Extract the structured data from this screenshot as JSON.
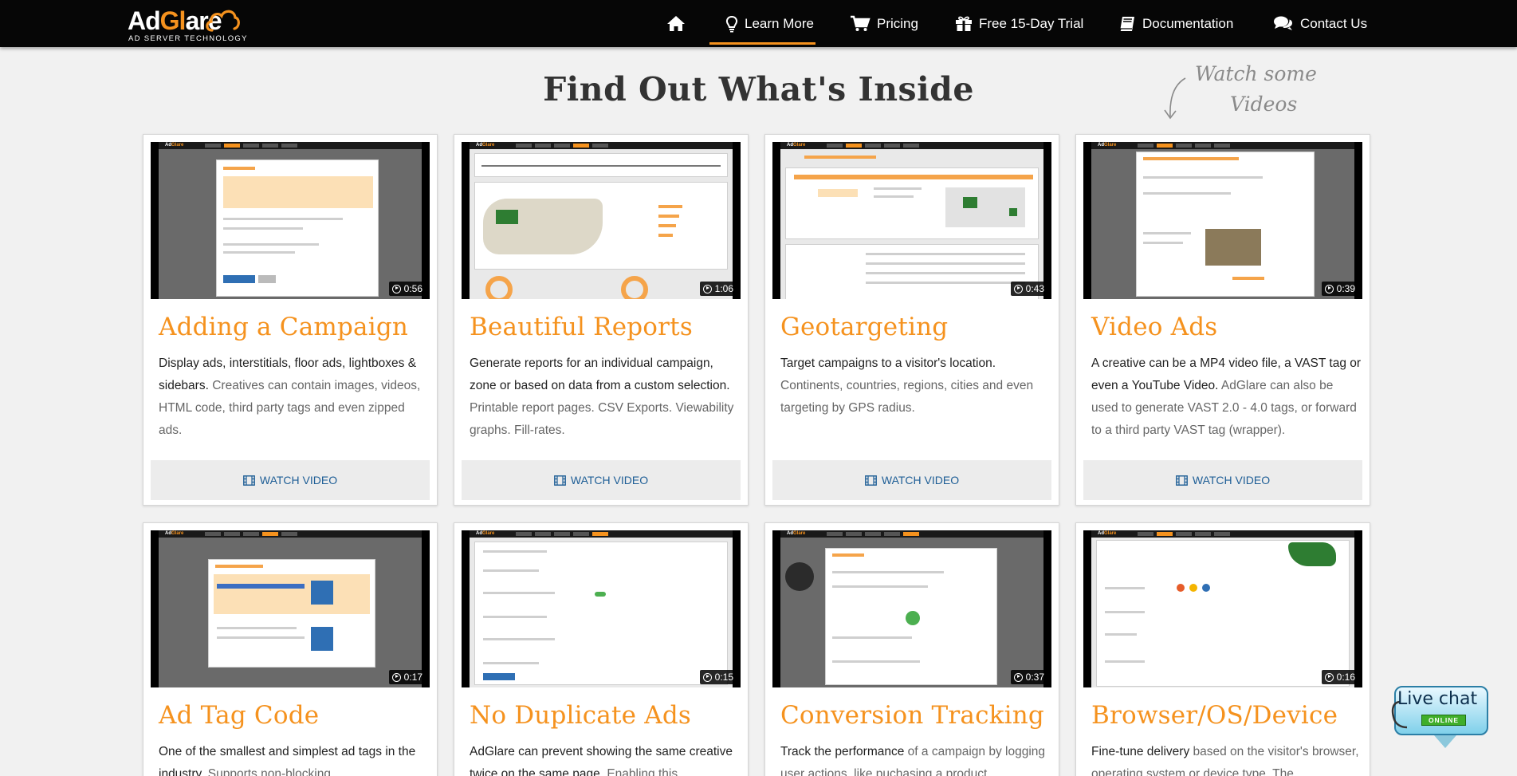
{
  "header": {
    "logo_text_1": "Ad",
    "logo_text_2": "Gl",
    "logo_text_3": "are",
    "logo_subtitle": "AD SERVER TECHNOLOGY",
    "nav": [
      {
        "label": "",
        "icon": "home-icon"
      },
      {
        "label": "Learn More",
        "icon": "lightbulb-icon",
        "active": true
      },
      {
        "label": "Pricing",
        "icon": "cart-icon"
      },
      {
        "label": "Free 15-Day Trial",
        "icon": "gift-icon"
      },
      {
        "label": "Documentation",
        "icon": "book-icon"
      },
      {
        "label": "Contact Us",
        "icon": "chat-bubbles-icon"
      }
    ]
  },
  "page": {
    "title": "Find Out What's Inside",
    "note_line1": "Watch some",
    "note_line2": "Videos",
    "accent_color": "#f5921e",
    "link_color": "#1e5e96"
  },
  "cards": [
    {
      "title": "Adding a Campaign",
      "duration": "0:56",
      "desc_strong": "Display ads, interstitials, floor ads, lightboxes & sidebars.",
      "desc_rest": " Creatives can contain images, videos, HTML code, third party tags and even zipped ads.",
      "button": "WATCH VIDEO"
    },
    {
      "title": "Beautiful Reports",
      "duration": "1:06",
      "desc_strong": "Generate reports for an individual campaign, zone or based on data from a custom selection.",
      "desc_rest": " Printable report pages. CSV Exports. Viewability graphs. Fill-rates.",
      "button": "WATCH VIDEO"
    },
    {
      "title": "Geotargeting",
      "duration": "0:43",
      "desc_strong": "Target campaigns to a visitor's location.",
      "desc_rest": " Continents, countries, regions, cities and even targeting by GPS radius.",
      "button": "WATCH VIDEO"
    },
    {
      "title": "Video Ads",
      "duration": "0:39",
      "desc_strong": "A creative can be a MP4 video file, a VAST tag or even a YouTube Video.",
      "desc_rest": " AdGlare can also be used to generate VAST 2.0 - 4.0 tags, or forward to a third party VAST tag (wrapper).",
      "button": "WATCH VIDEO"
    },
    {
      "title": "Ad Tag Code",
      "duration": "0:17",
      "desc_strong": "One of the smallest and simplest ad tags in the industry.",
      "desc_rest": " Supports non-blocking",
      "button": "WATCH VIDEO"
    },
    {
      "title": "No Duplicate Ads",
      "duration": "0:15",
      "desc_strong": "AdGlare can prevent showing the same creative twice on the same page.",
      "desc_rest": " Enabling this",
      "button": "WATCH VIDEO"
    },
    {
      "title": "Conversion Tracking",
      "duration": "0:37",
      "desc_strong": "Track the performance",
      "desc_rest": " of a campaign by logging user actions, like puchasing a product",
      "button": "WATCH VIDEO"
    },
    {
      "title": "Browser/OS/Device",
      "duration": "0:16",
      "desc_strong": "Fine-tune delivery",
      "desc_rest": " based on the visitor's browser, operating system or device type. The",
      "button": "WATCH VIDEO"
    }
  ],
  "livechat": {
    "label": "Live chat",
    "status": "ONLINE"
  }
}
